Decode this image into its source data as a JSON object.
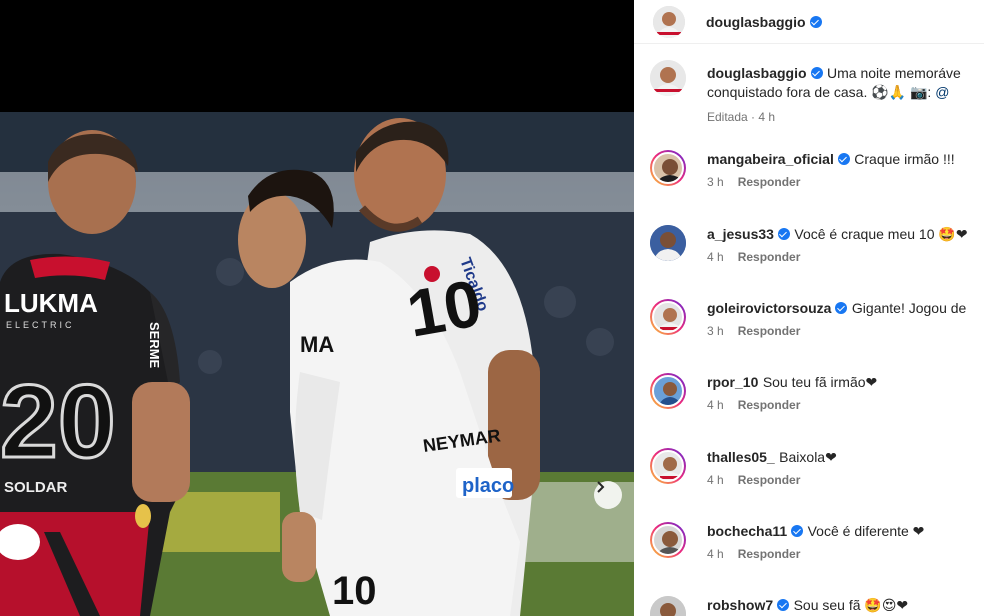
{
  "post_header": {
    "username": "douglasbaggio"
  },
  "caption": {
    "username": "douglasbaggio",
    "text_line1": "Uma noite memoráve",
    "text_line2": "conquistado fora de casa. ⚽🙏 📷: ",
    "mention": "@",
    "edited_label": "Editada · 4 h"
  },
  "comments": [
    {
      "username": "mangabeira_oficial",
      "verified": true,
      "text": "Craque irmão !!!",
      "time": "3 h",
      "reply": "Responder"
    },
    {
      "username": "a_jesus33",
      "verified": true,
      "text": "Você é craque meu 10 🤩❤",
      "time": "4 h",
      "reply": "Responder"
    },
    {
      "username": "goleirovictorsouza",
      "verified": true,
      "text": "Gigante! Jogou de",
      "time": "3 h",
      "reply": "Responder"
    },
    {
      "username": "rpor_10",
      "verified": false,
      "text": "Sou teu fã irmão❤",
      "time": "4 h",
      "reply": "Responder"
    },
    {
      "username": "thalles05_",
      "verified": false,
      "text": "Baixola❤",
      "time": "4 h",
      "reply": "Responder"
    },
    {
      "username": "bochecha11",
      "verified": true,
      "text": "Você é diferente ❤",
      "time": "4 h",
      "reply": "Responder"
    },
    {
      "username": "robshow7",
      "verified": true,
      "text": "Sou seu fã 🤩😍❤",
      "time": "",
      "reply": ""
    }
  ],
  "photo": {
    "jersey_left": "LUKMA",
    "jersey_left_sub": "ELECTRIC",
    "jersey_left_number": "20",
    "jersey_left_sponsor": "SERME",
    "jersey_left_sponsor2": "SOLDAR",
    "jersey_center_name": "NEYMAR",
    "jersey_center_number": "10",
    "jersey_center_sponsor": "placo",
    "jersey_center_chest": "MA",
    "jersey_right_sleeve": "Ticaldo"
  },
  "colors": {
    "verified": "#1877f2",
    "accent_red": "#c8102e",
    "santos_white": "#f2f2f2"
  }
}
